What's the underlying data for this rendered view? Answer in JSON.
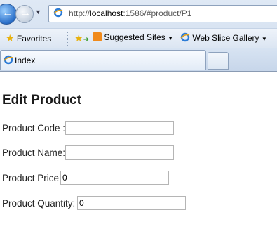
{
  "browser": {
    "url_prefix": "http://",
    "url_host": "localhost",
    "url_rest": ":1586/#product/P1",
    "favorites_label": "Favorites",
    "suggested_sites_label": "Suggested Sites",
    "web_slice_label": "Web Slice Gallery",
    "tab_title": "Index"
  },
  "page": {
    "title": "Edit Product",
    "fields": {
      "code": {
        "label": "Product Code :",
        "value": ""
      },
      "name": {
        "label": "Product Name:",
        "value": ""
      },
      "price": {
        "label": "Product Price:",
        "value": "0"
      },
      "quantity": {
        "label": "Product Quantity:",
        "value": "0"
      }
    }
  },
  "colors": {
    "chrome": "#cfdcee",
    "accent": "#2a6fc9",
    "input_border": "#b5b5b5"
  }
}
